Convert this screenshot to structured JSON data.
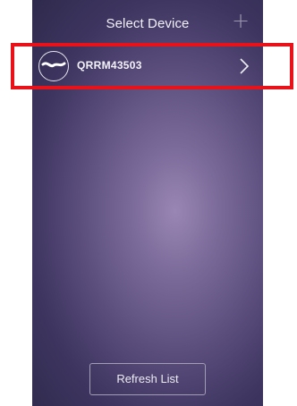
{
  "header": {
    "title": "Select Device",
    "add_icon": "plus-icon"
  },
  "devices": [
    {
      "name": "QRRM43503",
      "icon": "device-wave-icon",
      "action_icon": "chevron-right-icon"
    }
  ],
  "footer": {
    "refresh_label": "Refresh List"
  },
  "annotation": {
    "highlight_color": "#e8121b"
  },
  "colors": {
    "background_dark": "#2e2a4c",
    "background_light": "#9a86b4"
  }
}
